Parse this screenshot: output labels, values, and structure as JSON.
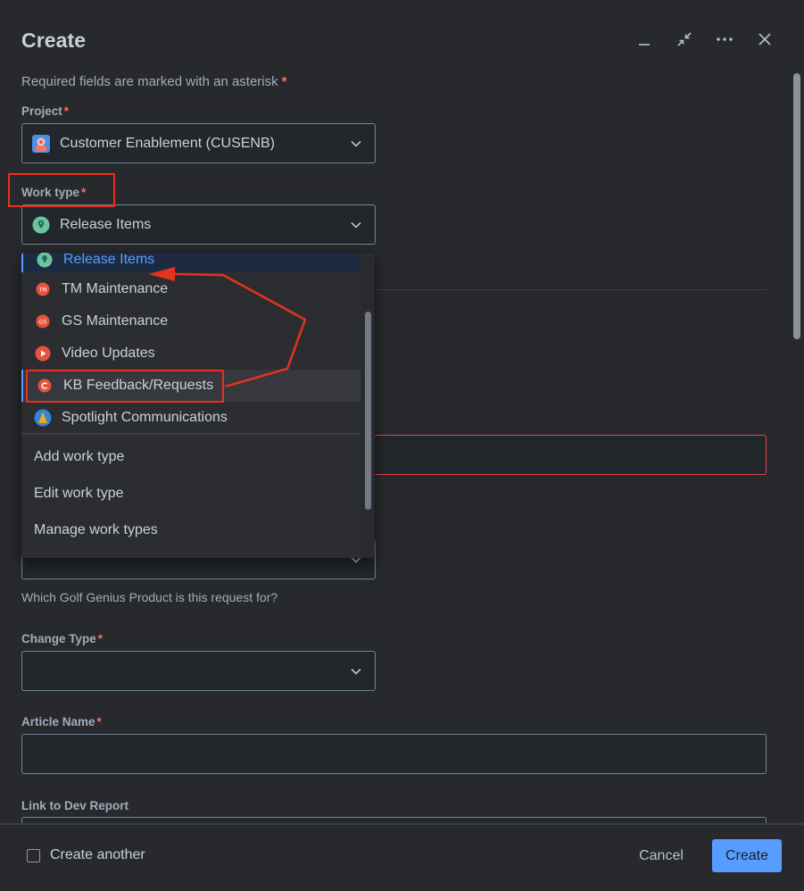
{
  "dialog": {
    "title": "Create",
    "required_note": "Required fields are marked with an asterisk",
    "required_marker": "*"
  },
  "project": {
    "label": "Project",
    "value": "Customer Enablement (CUSENB)"
  },
  "work_type": {
    "label": "Work type",
    "value": "Release Items",
    "options": [
      {
        "label": "Release Items",
        "icon": "pin-icon",
        "state": "selected"
      },
      {
        "label": "TM Maintenance",
        "icon": "tm-icon",
        "state": "normal"
      },
      {
        "label": "GS Maintenance",
        "icon": "gs-icon",
        "state": "normal"
      },
      {
        "label": "Video Updates",
        "icon": "play-icon",
        "state": "normal"
      },
      {
        "label": "KB Feedback/Requests",
        "icon": "kb-icon",
        "state": "hover"
      },
      {
        "label": "Spotlight Communications",
        "icon": "spotlight-icon",
        "state": "normal"
      }
    ],
    "actions": [
      "Add work type",
      "Edit work type",
      "Manage work types"
    ]
  },
  "product": {
    "helper": "Which Golf Genius Product is this request for?"
  },
  "change_type": {
    "label": "Change Type"
  },
  "article_name": {
    "label": "Article Name"
  },
  "dev_report": {
    "label": "Link to Dev Report"
  },
  "footer": {
    "create_another": "Create another",
    "cancel": "Cancel",
    "create": "Create"
  },
  "colors": {
    "accent": "#579dff",
    "required": "#f87168",
    "annotation": "#e5321f"
  }
}
